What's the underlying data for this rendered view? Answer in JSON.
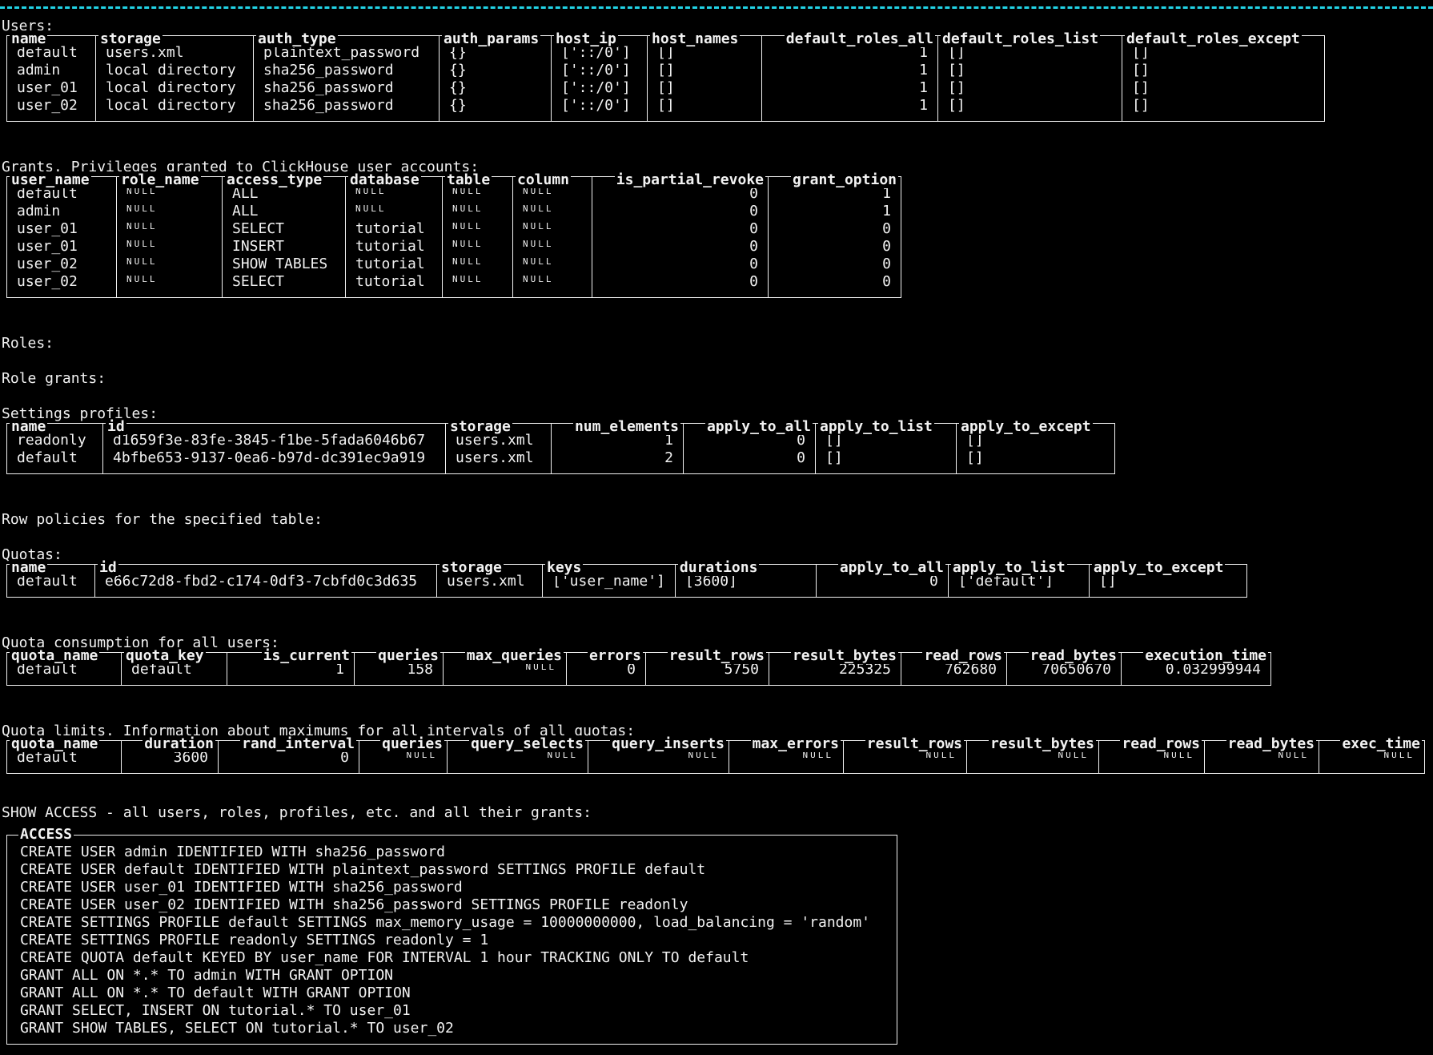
{
  "users": {
    "label": "Users:",
    "columns": [
      "name",
      "storage",
      "auth_type",
      "auth_params",
      "host_ip",
      "host_names",
      "default_roles_all",
      "default_roles_list",
      "default_roles_except"
    ],
    "rows": [
      [
        "default",
        "users.xml",
        "plaintext_password",
        "{}",
        "['::/0']",
        "[]",
        "1",
        "[]",
        "[]"
      ],
      [
        "admin",
        "local directory",
        "sha256_password",
        "{}",
        "['::/0']",
        "[]",
        "1",
        "[]",
        "[]"
      ],
      [
        "user_01",
        "local directory",
        "sha256_password",
        "{}",
        "['::/0']",
        "[]",
        "1",
        "[]",
        "[]"
      ],
      [
        "user_02",
        "local directory",
        "sha256_password",
        "{}",
        "['::/0']",
        "[]",
        "1",
        "[]",
        "[]"
      ]
    ]
  },
  "grants": {
    "label": "Grants. Privileges granted to ClickHouse user accounts:",
    "columns": [
      "user_name",
      "role_name",
      "access_type",
      "database",
      "table",
      "column",
      "is_partial_revoke",
      "grant_option"
    ],
    "rows": [
      [
        "default",
        "NULL",
        "ALL",
        "NULL",
        "NULL",
        "NULL",
        "0",
        "1"
      ],
      [
        "admin",
        "NULL",
        "ALL",
        "NULL",
        "NULL",
        "NULL",
        "0",
        "1"
      ],
      [
        "user_01",
        "NULL",
        "SELECT",
        "tutorial",
        "NULL",
        "NULL",
        "0",
        "0"
      ],
      [
        "user_01",
        "NULL",
        "INSERT",
        "tutorial",
        "NULL",
        "NULL",
        "0",
        "0"
      ],
      [
        "user_02",
        "NULL",
        "SHOW TABLES",
        "tutorial",
        "NULL",
        "NULL",
        "0",
        "0"
      ],
      [
        "user_02",
        "NULL",
        "SELECT",
        "tutorial",
        "NULL",
        "NULL",
        "0",
        "0"
      ]
    ]
  },
  "roles": {
    "label": "Roles:"
  },
  "role_grants": {
    "label": "Role grants:"
  },
  "settings_profiles": {
    "label": "Settings profiles:",
    "columns": [
      "name",
      "id",
      "storage",
      "num_elements",
      "apply_to_all",
      "apply_to_list",
      "apply_to_except"
    ],
    "rows": [
      [
        "readonly",
        "d1659f3e-83fe-3845-f1be-5fada6046b67",
        "users.xml",
        "1",
        "0",
        "[]",
        "[]"
      ],
      [
        "default",
        "4bfbe653-9137-0ea6-b97d-dc391ec9a919",
        "users.xml",
        "2",
        "0",
        "[]",
        "[]"
      ]
    ]
  },
  "row_policies": {
    "label": "Row policies for the specified table:"
  },
  "quotas": {
    "label": "Quotas:",
    "columns": [
      "name",
      "id",
      "storage",
      "keys",
      "durations",
      "apply_to_all",
      "apply_to_list",
      "apply_to_except"
    ],
    "rows": [
      [
        "default",
        "e66c72d8-fbd2-c174-0df3-7cbfd0c3d635",
        "users.xml",
        "['user_name']",
        "[3600]",
        "0",
        "['default']",
        "[]"
      ]
    ]
  },
  "quota_consumption": {
    "label": "Quota consumption for all users:",
    "columns": [
      "quota_name",
      "quota_key",
      "is_current",
      "queries",
      "max_queries",
      "errors",
      "result_rows",
      "result_bytes",
      "read_rows",
      "read_bytes",
      "execution_time"
    ],
    "rows": [
      [
        "default",
        "default",
        "1",
        "158",
        "NULL",
        "0",
        "5750",
        "225325",
        "762680",
        "70650670",
        "0.032999944"
      ]
    ]
  },
  "quota_limits": {
    "label": "Quota limits. Information about maximums for all intervals of all quotas:",
    "columns": [
      "quota_name",
      "duration",
      "rand_interval",
      "queries",
      "query_selects",
      "query_inserts",
      "max_errors",
      "result_rows",
      "result_bytes",
      "read_rows",
      "read_bytes",
      "exec_time"
    ],
    "rows": [
      [
        "default",
        "3600",
        "0",
        "NULL",
        "NULL",
        "NULL",
        "NULL",
        "NULL",
        "NULL",
        "NULL",
        "NULL",
        "NULL"
      ]
    ]
  },
  "show_access": {
    "label": "SHOW ACCESS - all users, roles, profiles, etc. and all their grants:",
    "header": "ACCESS",
    "lines": [
      "CREATE USER admin IDENTIFIED WITH sha256_password",
      "CREATE USER default IDENTIFIED WITH plaintext_password SETTINGS PROFILE default",
      "CREATE USER user_01 IDENTIFIED WITH sha256_password",
      "CREATE USER user_02 IDENTIFIED WITH sha256_password SETTINGS PROFILE readonly",
      "CREATE SETTINGS PROFILE default SETTINGS max_memory_usage = 10000000000, load_balancing = 'random'",
      "CREATE SETTINGS PROFILE readonly SETTINGS readonly = 1",
      "CREATE QUOTA default KEYED BY user_name FOR INTERVAL 1 hour TRACKING ONLY TO default",
      "GRANT ALL ON *.* TO admin WITH GRANT OPTION",
      "GRANT ALL ON *.* TO default WITH GRANT OPTION",
      "GRANT SELECT, INSERT ON tutorial.* TO user_01",
      "GRANT SHOW TABLES, SELECT ON tutorial.* TO user_02"
    ]
  },
  "colors": {
    "background": "#000000",
    "text": "#f2f2f2",
    "rule": "#22d3e6"
  }
}
